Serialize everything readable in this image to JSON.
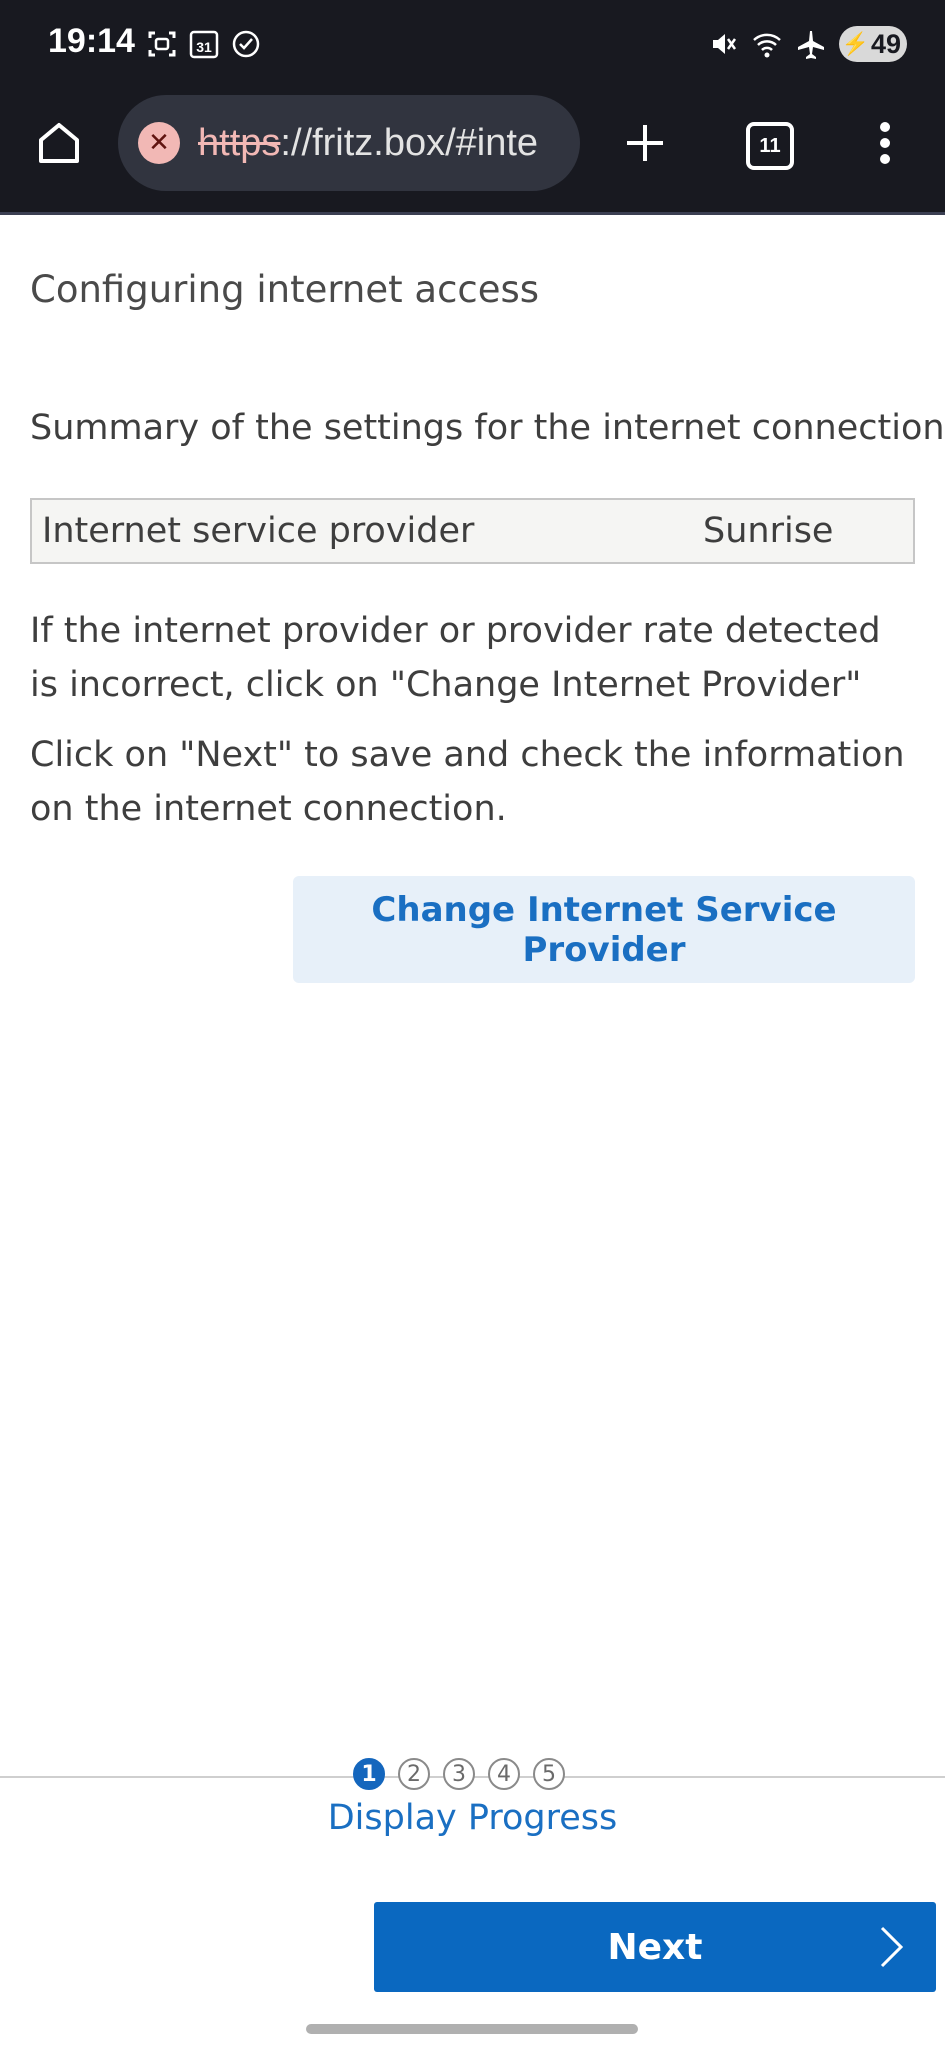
{
  "status_bar": {
    "time": "19:14",
    "calendar_day": "31",
    "battery_level": "49",
    "icons": [
      "screenshot-icon",
      "calendar-icon",
      "check-circle-icon",
      "mute-icon",
      "wifi-icon",
      "airplane-icon",
      "battery-icon"
    ]
  },
  "browser": {
    "url_scheme": "https",
    "url_rest": "://fritz.box/#inte",
    "tab_count": "11"
  },
  "page": {
    "title": "Configuring internet access",
    "summary_heading": "Summary of the settings for the internet connection",
    "provider_label": "Internet service provider",
    "provider_value": "Sunrise",
    "info_line_1": "If the internet provider or provider rate detected is incorrect, click on \"Change Internet Provider\"",
    "info_line_2": "Click on \"Next\" to save and check the information on the internet connection.",
    "change_button": "Change Internet Service Provider"
  },
  "progress": {
    "steps": [
      "1",
      "2",
      "3",
      "4",
      "5"
    ],
    "current_step": 1,
    "label": "Display Progress"
  },
  "footer": {
    "next_button": "Next"
  },
  "colors": {
    "accent": "#0a68c0",
    "link": "#1a6fc2",
    "toolbar_bg": "#181920"
  }
}
